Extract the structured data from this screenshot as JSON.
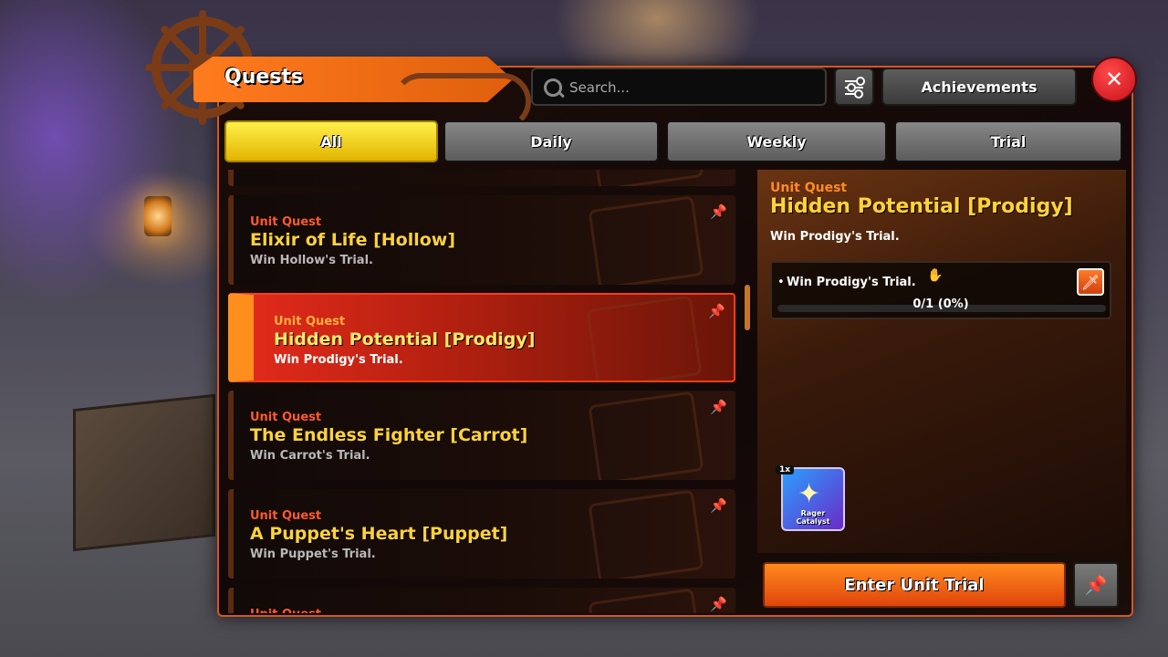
{
  "header": {
    "title": "Quests",
    "search_placeholder": "Search...",
    "achievements_label": "Achievements",
    "close_label": "✕"
  },
  "tabs": [
    {
      "label": "All",
      "active": true
    },
    {
      "label": "Daily",
      "active": false
    },
    {
      "label": "Weekly",
      "active": false
    },
    {
      "label": "Trial",
      "active": false
    }
  ],
  "quests": [
    {
      "type": "Unit Quest",
      "title": "Elixir of Life [Hollow]",
      "desc": "Win Hollow's Trial."
    },
    {
      "type": "Unit Quest",
      "title": "Hidden Potential [Prodigy]",
      "desc": "Win Prodigy's Trial.",
      "selected": true
    },
    {
      "type": "Unit Quest",
      "title": "The Endless Fighter [Carrot]",
      "desc": "Win Carrot's Trial."
    },
    {
      "type": "Unit Quest",
      "title": "A Puppet's Heart [Puppet]",
      "desc": "Win Puppet's Trial."
    },
    {
      "type": "Unit Quest",
      "title": "",
      "desc": ""
    }
  ],
  "detail": {
    "type": "Unit Quest",
    "title": "Hidden Potential [Prodigy]",
    "desc": "Win Prodigy's Trial.",
    "task": {
      "text": "Win Prodigy's Trial.",
      "progress_text": "0/1 (0%)",
      "progress_fraction": 0
    },
    "reward": {
      "qty": "1x",
      "name": "Rager Catalyst"
    },
    "enter_label": "Enter Unit Trial"
  },
  "colors": {
    "accent": "#ff7b1e",
    "active_tab": "#f5d21a",
    "title_gold": "#ffd23a",
    "close_red": "#d41a22"
  },
  "icons": {
    "search": "search-icon",
    "filter": "filter-icon",
    "pin": "pin-icon",
    "sword": "sword-icon",
    "scroll": "scroll-icon",
    "close": "close-icon"
  }
}
